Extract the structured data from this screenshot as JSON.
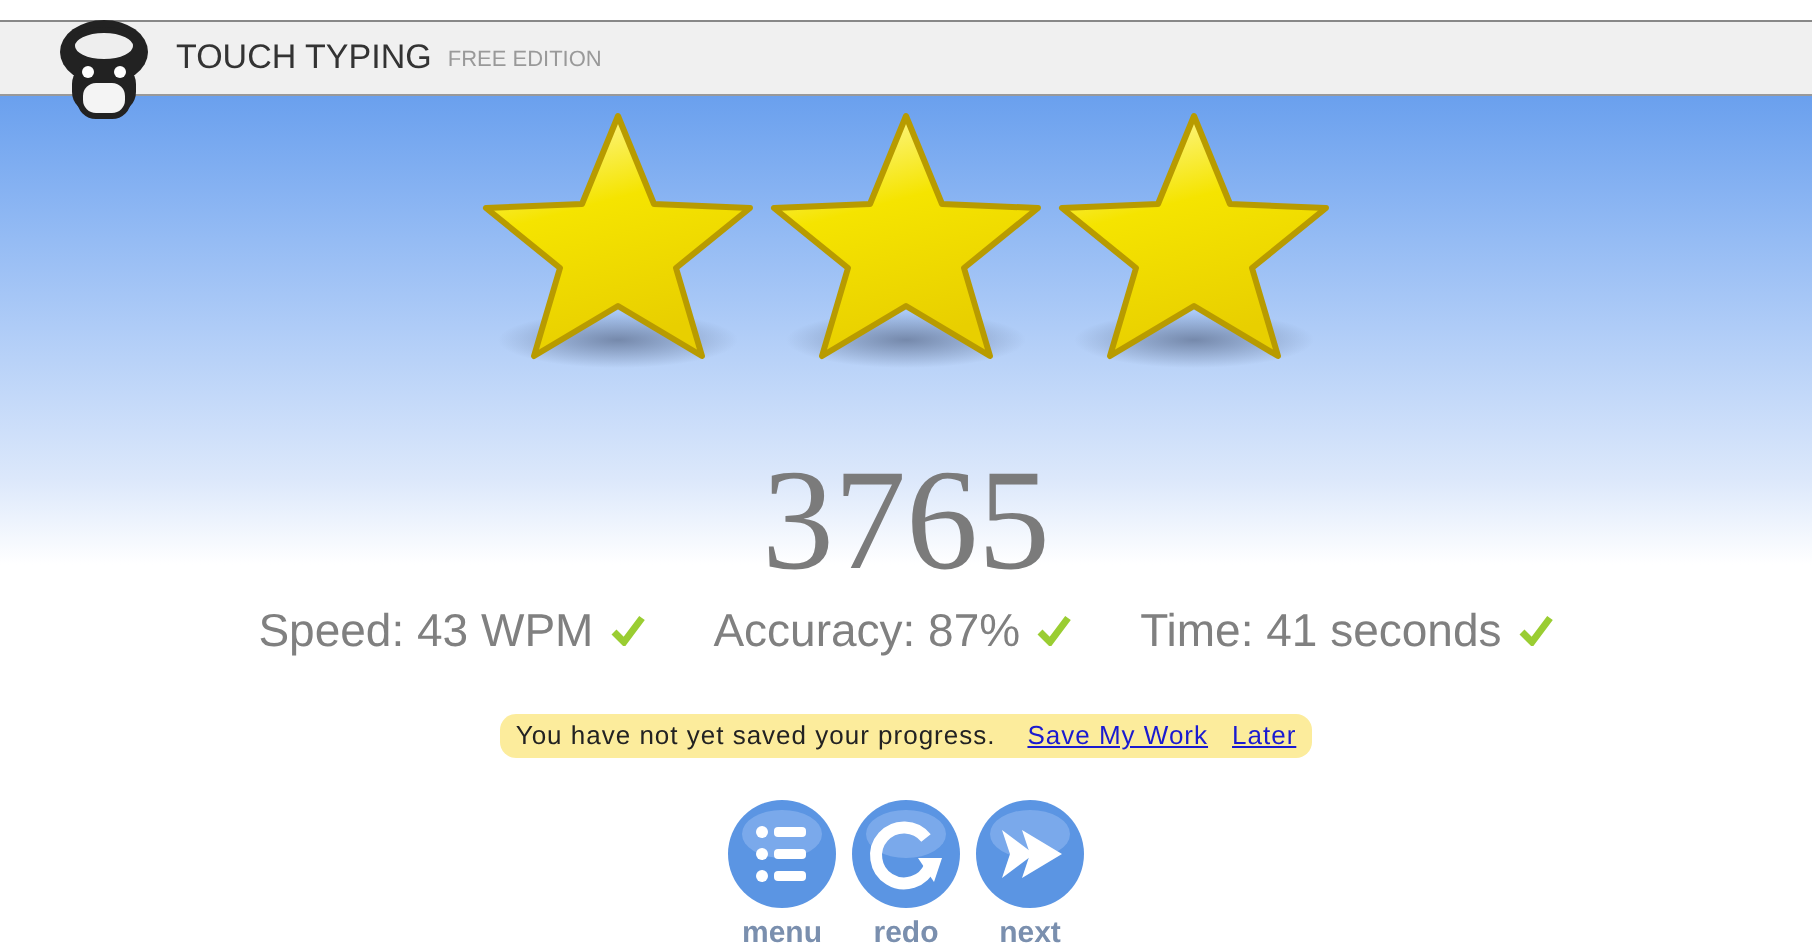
{
  "header": {
    "title": "TOUCH TYPING",
    "edition": "FREE EDITION"
  },
  "result": {
    "stars": 3,
    "score": "3765"
  },
  "stats": [
    {
      "label": "Speed: 43 WPM",
      "met": true
    },
    {
      "label": "Accuracy: 87%",
      "met": true
    },
    {
      "label": "Time: 41 seconds",
      "met": true
    }
  ],
  "notice": {
    "message": "You have not yet saved your progress.",
    "links": [
      "Save My Work",
      "Later"
    ]
  },
  "actions": [
    {
      "kind": "menu",
      "label": "menu"
    },
    {
      "kind": "redo",
      "label": "redo"
    },
    {
      "kind": "next",
      "label": "next"
    }
  ]
}
